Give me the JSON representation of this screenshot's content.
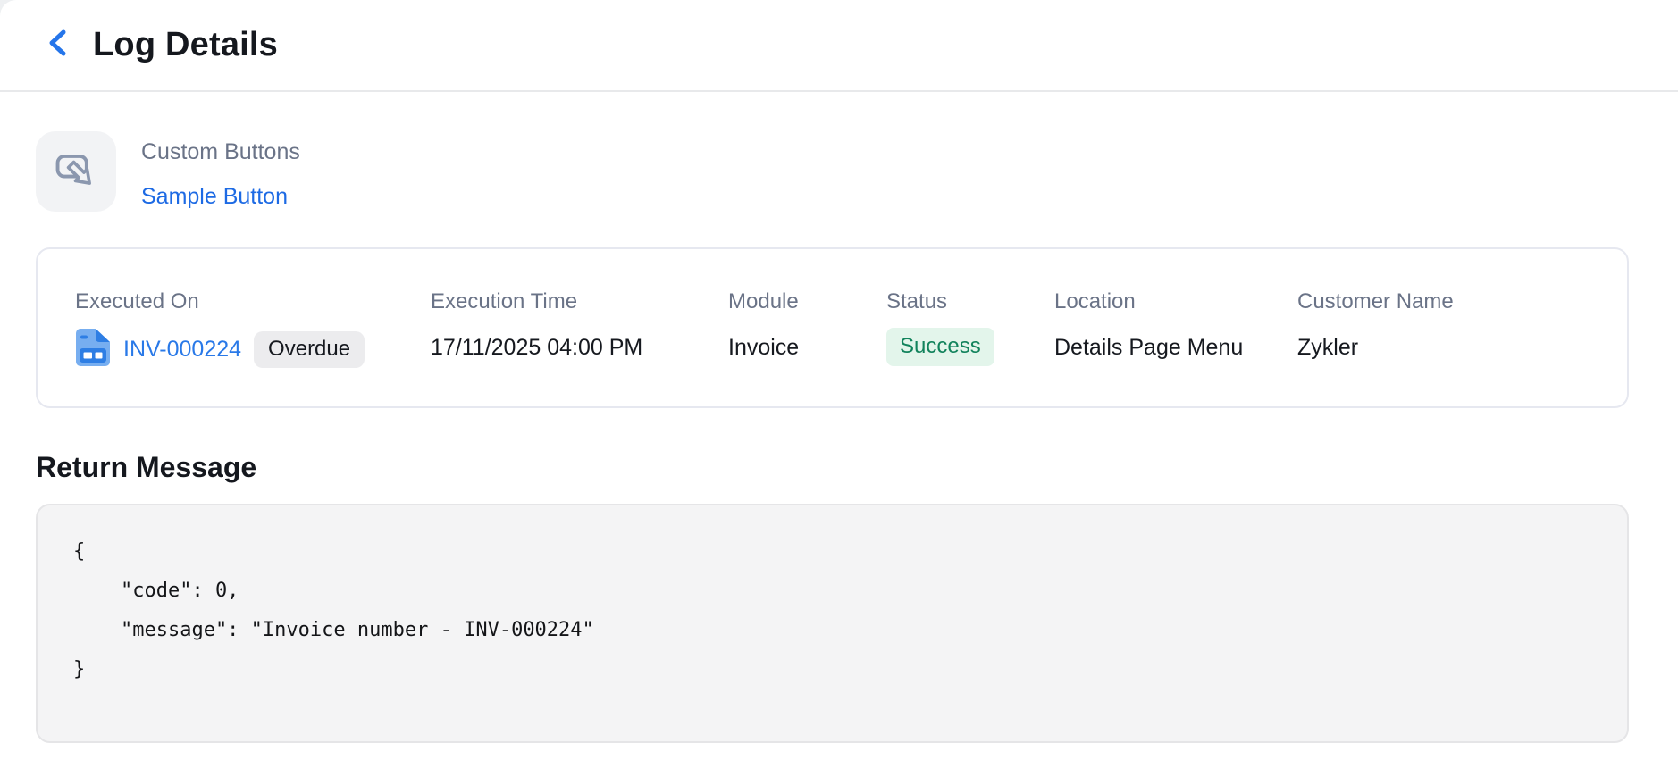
{
  "header": {
    "title": "Log Details"
  },
  "custom_buttons": {
    "section_label": "Custom Buttons",
    "button_name": "Sample Button"
  },
  "log": {
    "executed_on": {
      "label": "Executed On",
      "invoice_number": "INV-000224",
      "badge": "Overdue"
    },
    "execution_time": {
      "label": "Execution Time",
      "value": "17/11/2025 04:00 PM"
    },
    "module": {
      "label": "Module",
      "value": "Invoice"
    },
    "status": {
      "label": "Status",
      "value": "Success"
    },
    "location": {
      "label": "Location",
      "value": "Details Page Menu"
    },
    "customer": {
      "label": "Customer Name",
      "value": "Zykler"
    }
  },
  "return_message": {
    "heading": "Return Message",
    "body": "{\n    \"code\": 0,\n    \"message\": \"Invoice number - INV-000224\"\n}"
  },
  "icons": {
    "back": "chevron-left-icon",
    "custom_button": "button-click-icon",
    "invoice": "invoice-document-icon"
  },
  "colors": {
    "accent_blue": "#2575ea",
    "link_blue": "#1d6ae4",
    "invoice_link_blue": "#2979e8",
    "success_text": "#12835c",
    "success_bg": "#e3f5eb",
    "overdue_bg": "#ececee",
    "label_gray": "#6a7387",
    "icon_slate": "#8b97ae",
    "invoice_icon_light": "#77aef0",
    "invoice_icon_dark": "#2e7ee4",
    "code_bg": "#f4f4f5"
  }
}
